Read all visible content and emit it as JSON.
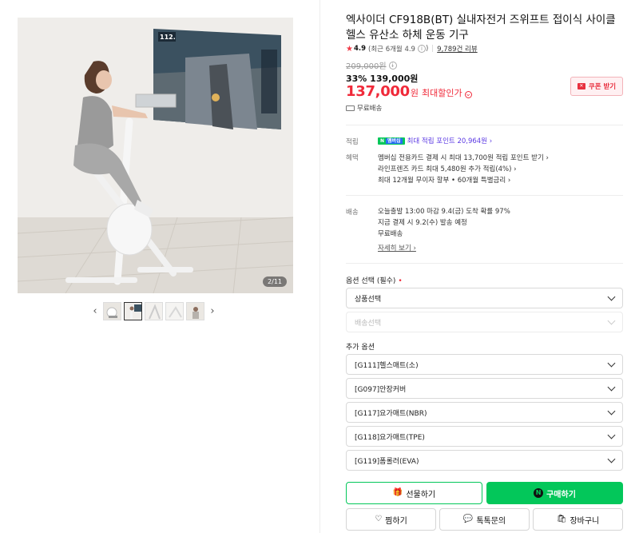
{
  "gallery": {
    "counter": "2/11",
    "prev_label": "‹",
    "next_label": "›",
    "screen_stat": "112."
  },
  "product": {
    "title": "엑사이더 CF918B(BT) 실내자전거 즈위프트 접이식 사이클 헬스 유산소 하체 운동 기구",
    "rating_score": "4.9",
    "rating_recent": "(최근 6개월 4.9",
    "review_count": "9,789건 리뷰",
    "original_price": "209,000원",
    "discount": "33% 139,000원",
    "max_price_num": "137,000",
    "max_price_won": "원",
    "max_price_label": "최대할인가",
    "coupon_label": "쿠폰 받기",
    "coupon_icon": "coupon-icon",
    "free_shipping": "무료배송"
  },
  "points": {
    "label": "적립",
    "npay": "N",
    "npay_membership": "멤버십",
    "text": "최대 적립 포인트 20,964원",
    "arrow": "›"
  },
  "benefits": {
    "label": "혜택",
    "lines": [
      "멤버십 전용카드 결제 시 최대 13,700원 적립 포인트 받기 ›",
      "라인프렌즈 카드 최대 5,480원 추가 적립(4%) ›",
      "최대 12개월 무이자 할부 • 60개월 특별금리 ›"
    ]
  },
  "delivery": {
    "label": "배송",
    "line1": "오늘출발 13:00 마감    9.4(금) 도착 확률 97%",
    "line2": "지금 결제 시 9.2(수) 발송 예정",
    "line3": "무료배송",
    "detail_link": "자세히 보기 ›"
  },
  "options": {
    "required_label": "옵션 선택 (필수)",
    "required_mark": "•",
    "product_select": "상품선택",
    "shipping_select": "배송선택",
    "additional_label": "추가 옵션",
    "additional": [
      "[G111]헬스매트(소)",
      "[G097]안장커버",
      "[G117]요가매트(NBR)",
      "[G118]요가매트(TPE)",
      "[G119]폼롤러(EVA)"
    ]
  },
  "actions": {
    "gift": "선물하기",
    "buy": "구매하기",
    "buy_badge": "N",
    "wish": "찜하기",
    "talk": "톡톡문의",
    "cart": "장바구니"
  },
  "colors": {
    "accent_green": "#03c75a",
    "price_red": "#f02a3a",
    "points_purple": "#5b39e3"
  }
}
